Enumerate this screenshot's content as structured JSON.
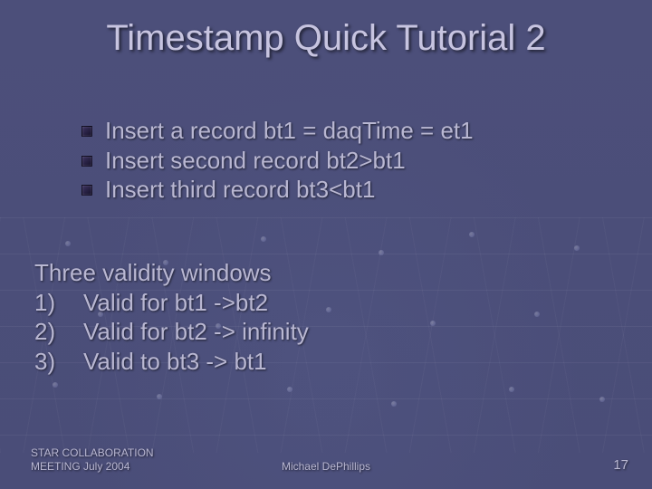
{
  "title": "Timestamp Quick Tutorial 2",
  "bullets": [
    "Insert a record bt1 = daqTime = et1",
    "Insert second record bt2>bt1",
    "Insert third record bt3<bt1"
  ],
  "section2_heading": "Three validity windows",
  "section2_items": [
    {
      "num": "1)",
      "text": "Valid for bt1 ->bt2"
    },
    {
      "num": "2)",
      "text": "Valid for bt2 -> infinity"
    },
    {
      "num": "3)",
      "text": "Valid to bt3 -> bt1"
    }
  ],
  "footer": {
    "left_line1": "STAR COLLABORATION",
    "left_line2": "MEETING  July 2004",
    "center": "Michael DePhillips",
    "page": "17"
  }
}
